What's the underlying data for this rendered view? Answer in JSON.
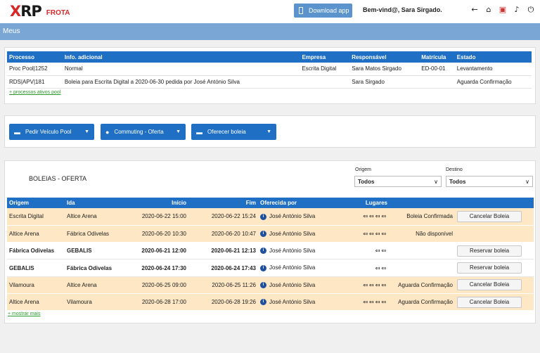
{
  "app": {
    "logo_main": "XRP",
    "logo_sub": "FROTA",
    "download_label": "Download app",
    "welcome": "Bem-vind@, Sara Sirgado."
  },
  "icons": [
    "back-arrow-icon",
    "home-icon",
    "pdf-icon",
    "bell-icon",
    "power-icon"
  ],
  "section_title": "Meus",
  "processes": {
    "headers": [
      "Processo",
      "Info. adicional",
      "Empresa",
      "Responsável",
      "Matrícula",
      "Estado"
    ],
    "rows": [
      [
        "Proc Pool|1252",
        "Normal",
        "Escrita Digital",
        "Sara Matos Sirgado",
        "ED-00-01",
        "Levantamento"
      ],
      [
        "RDS|APV|181",
        "Boleia para Escrita Digital a 2020-06-30 pedida por José António Silva",
        "",
        "Sara Sirgado",
        "",
        "Aguarda Confirmação"
      ]
    ],
    "more_link": "+ processos ativos pool"
  },
  "actions": {
    "pedir": "Pedir Veículo Pool",
    "commuting": "Commuting - Oferta",
    "oferecer": "Oferecer boleia"
  },
  "boleias": {
    "title": "BOLEIAS - OFERTA",
    "origem_label": "Origem",
    "origem_value": "Todos",
    "destino_label": "Destino",
    "destino_value": "Todos",
    "headers": [
      "Origem",
      "Ida",
      "Início",
      "Fim",
      "Oferecida por",
      "Lugares",
      "",
      ""
    ],
    "rows": [
      {
        "origem": "Escrita Digital",
        "ida": "Altice Arena",
        "inicio": "2020-06-22 15:00",
        "fim": "2020-06-22 15:24",
        "por": "José António Silva",
        "seats": "⤆⤆⤆⤆",
        "estado": "Boleia Confirmada",
        "action": "Cancelar Boleia",
        "hl": true
      },
      {
        "origem": "Altice Arena",
        "ida": "Fábrica Odivelas",
        "inicio": "2020-06-20 10:30",
        "fim": "2020-06-20 10:47",
        "por": "José António Silva",
        "seats": "⤆⤆⤆⤆",
        "estado": "Não disponível",
        "action": "",
        "hl": true
      },
      {
        "origem": "Fábrica Odivelas",
        "ida": "GEBALIS",
        "inicio": "2020-06-21 12:00",
        "fim": "2020-06-21 12:13",
        "por": "José António Silva",
        "seats": "⤆⤆",
        "estado": "",
        "action": "Reservar boleia",
        "hl": false
      },
      {
        "origem": "GEBALIS",
        "ida": "Fábrica Odivelas",
        "inicio": "2020-06-24 17:30",
        "fim": "2020-06-24 17:43",
        "por": "José António Silva",
        "seats": "⤆⤆",
        "estado": "",
        "action": "Reservar boleia",
        "hl": false
      },
      {
        "origem": "Vilamoura",
        "ida": "Altice Arena",
        "inicio": "2020-06-25 09:00",
        "fim": "2020-06-25 11:26",
        "por": "José António Silva",
        "seats": "⤆⤆⤆⤆",
        "estado": "Aguarda Confirmação",
        "action": "Cancelar Boleia",
        "hl": true
      },
      {
        "origem": "Altice Arena",
        "ida": "Vilamoura",
        "inicio": "2020-06-28 17:00",
        "fim": "2020-06-28 19:26",
        "por": "José António Silva",
        "seats": "⤆⤆⤆⤆",
        "estado": "Aguarda Confirmação",
        "action": "Cancelar Boleia",
        "hl": true
      }
    ],
    "more_link": "+ mostrar mais"
  }
}
